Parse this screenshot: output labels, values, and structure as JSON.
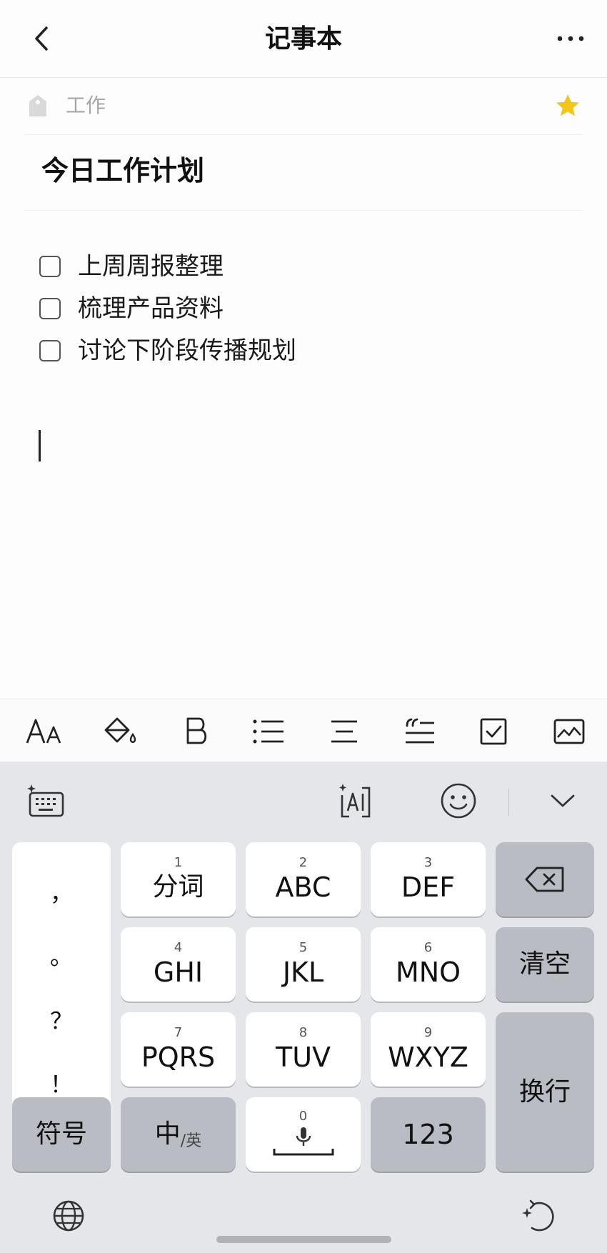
{
  "nav": {
    "title": "记事本"
  },
  "category": {
    "label": "工作",
    "starred": true,
    "star_color": "#f5c518"
  },
  "note": {
    "title": "今日工作计划",
    "todos": [
      {
        "label": "上周周报整理",
        "checked": false
      },
      {
        "label": "梳理产品资料",
        "checked": false
      },
      {
        "label": "讨论下阶段传播规划",
        "checked": false
      }
    ]
  },
  "toolbar": {
    "icons": [
      "font-size-icon",
      "fill-color-icon",
      "bold-icon",
      "bullet-list-icon",
      "align-icon",
      "quote-icon",
      "checkbox-icon",
      "image-icon"
    ],
    "font_size_glyph": "AA"
  },
  "keyboard": {
    "punctuation": [
      "，",
      "。",
      "？",
      "！"
    ],
    "keys": [
      {
        "num": "1",
        "label": "分词"
      },
      {
        "num": "2",
        "label": "ABC"
      },
      {
        "num": "3",
        "label": "DEF"
      },
      {
        "num": "4",
        "label": "GHI"
      },
      {
        "num": "5",
        "label": "JKL"
      },
      {
        "num": "6",
        "label": "MNO"
      },
      {
        "num": "7",
        "label": "PQRS"
      },
      {
        "num": "8",
        "label": "TUV"
      },
      {
        "num": "9",
        "label": "WXYZ"
      },
      {
        "num": "0",
        "label": ""
      }
    ],
    "clear_label": "清空",
    "enter_label": "换行",
    "symbol_label": "符号",
    "lang_main": "中",
    "lang_sub": "/英",
    "num_label": "123"
  }
}
